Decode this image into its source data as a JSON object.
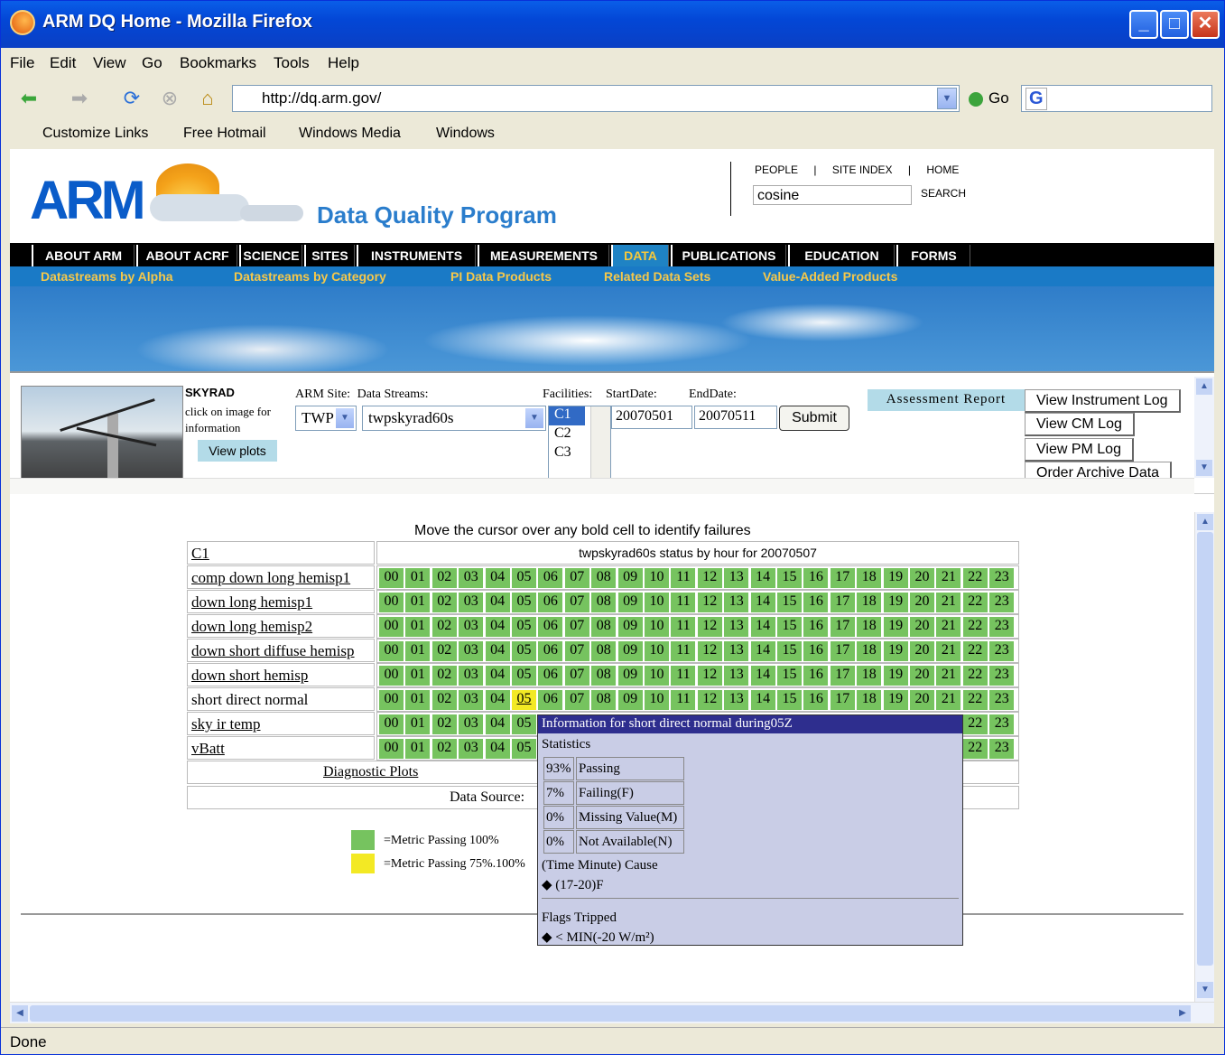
{
  "window": {
    "title": "ARM DQ Home - Mozilla Firefox"
  },
  "menu": [
    "File",
    "Edit",
    "View",
    "Go",
    "Bookmarks",
    "Tools",
    "Help"
  ],
  "nav": {
    "url": "http://dq.arm.gov/",
    "go_label": "Go"
  },
  "links_bar": [
    "Customize Links",
    "Free Hotmail",
    "Windows Media",
    "Windows"
  ],
  "header": {
    "logo": "ARM",
    "program": "Data Quality Program",
    "people": "PEOPLE",
    "site_index": "SITE INDEX",
    "home": "HOME",
    "sep": "|",
    "search_value": "cosine",
    "search_label": "SEARCH"
  },
  "tabs": [
    "ABOUT ARM",
    "ABOUT ACRF",
    "SCIENCE",
    "SITES",
    "INSTRUMENTS",
    "MEASUREMENTS",
    "DATA",
    "PUBLICATIONS",
    "EDUCATION",
    "FORMS"
  ],
  "selected_tab": "DATA",
  "subnav": [
    "Datastreams by Alpha",
    "Datastreams by Category",
    "PI Data Products",
    "Related Data Sets",
    "Value-Added Products"
  ],
  "form": {
    "instrument": "SKYRAD",
    "click_hint": "click on image for information",
    "view_plots": "View plots",
    "site_label": "ARM Site:",
    "streams_label": "Data Streams:",
    "site_value": "TWP",
    "stream_value": "twpskyrad60s",
    "facilities_label": "Facilities:",
    "facilities": [
      "C1",
      "C2",
      "C3"
    ],
    "start_label": "StartDate:",
    "start_value": "20070501",
    "end_label": "EndDate:",
    "end_value": "20070511",
    "submit": "Submit",
    "assessment": "Assessment Report",
    "log_buttons": [
      "View Instrument Log",
      "View CM Log",
      "View PM Log",
      "Order Archive Data"
    ]
  },
  "status": {
    "hint": "Move the cursor over any bold cell to identify failures",
    "facility_link": "C1",
    "table_title": "twpskyrad60s status by hour for 20070507",
    "hours": [
      "00",
      "01",
      "02",
      "03",
      "04",
      "05",
      "06",
      "07",
      "08",
      "09",
      "10",
      "11",
      "12",
      "13",
      "14",
      "15",
      "16",
      "17",
      "18",
      "19",
      "20",
      "21",
      "22",
      "23"
    ],
    "rows": [
      {
        "label": "comp down long hemisp1",
        "link": true
      },
      {
        "label": "down long hemisp1",
        "link": true
      },
      {
        "label": "down  long  hemisp2",
        "link": true
      },
      {
        "label": "down  short  diffuse  hemisp",
        "link": true
      },
      {
        "label": "down  short  hemisp",
        "link": true
      },
      {
        "label": "short  direct  normal",
        "link": false
      },
      {
        "label": "sky ir temp",
        "link": true
      },
      {
        "label": "vBatt",
        "link": true
      }
    ],
    "yellow_cell": {
      "row": 5,
      "hour": "05"
    },
    "diagnostic": "Diagnostic Plots",
    "data_source": "Data Source:",
    "legend": [
      {
        "color": "#76c35f",
        "text": "=Metric Passing 100%"
      },
      {
        "color": "#f3e924",
        "text": "=Metric Passing 75%.100%"
      }
    ]
  },
  "popup": {
    "title": "Information for short direct normal during05Z",
    "stats_label": "Statistics",
    "stats": [
      {
        "pct": "93%",
        "text": "Passing"
      },
      {
        "pct": "7%",
        "text": "Failing(F)"
      },
      {
        "pct": "0%",
        "text": "Missing Value(M)"
      },
      {
        "pct": "0%",
        "text": "Not Available(N)"
      }
    ],
    "cause_label": "(Time Minute) Cause",
    "cause_value": "◆  (17-20)F",
    "flags_label": "Flags Tripped",
    "flags_value": "◆  < MIN(-20 W/m²)"
  },
  "statusbar": "Done"
}
